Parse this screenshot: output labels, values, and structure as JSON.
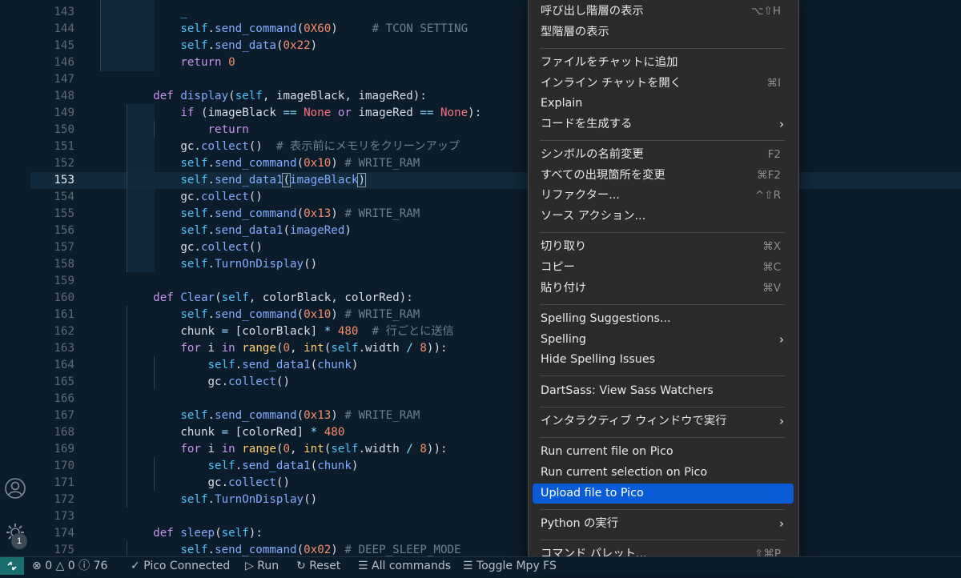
{
  "editor": {
    "current_line": 153,
    "lines": [
      {
        "n": "143",
        "html": "        <span class=\"self\">_</span>"
      },
      {
        "n": "144",
        "html": "        <span class=\"self\">self</span>.<span class=\"fn\">send_command</span>(<span class=\"num\">0X60</span>)     <span class=\"cm\"># TCON SETTING</span>"
      },
      {
        "n": "145",
        "html": "        <span class=\"self\">self</span>.<span class=\"fn\">send_data</span>(<span class=\"num\">0x22</span>)"
      },
      {
        "n": "146",
        "html": "        <span class=\"kw\">return</span> <span class=\"num\">0</span>"
      },
      {
        "n": "147",
        "html": ""
      },
      {
        "n": "148",
        "html": "    <span class=\"kw\">def</span> <span class=\"fn\">display</span>(<span class=\"self\">self</span>, imageBlack, imageRed):"
      },
      {
        "n": "149",
        "html": "        <span class=\"kw\">if</span> (imageBlack <span class=\"op\">==</span> <span class=\"none\">None</span> <span class=\"kw\">or</span> imageRed <span class=\"op\">==</span> <span class=\"none\">None</span>):"
      },
      {
        "n": "150",
        "html": "            <span class=\"kw\">return</span>"
      },
      {
        "n": "151",
        "html": "        gc.<span class=\"fn\">collect</span>()  <span class=\"cm\"># 表示前にメモリをクリーンアップ</span>"
      },
      {
        "n": "152",
        "html": "        <span class=\"self\">self</span>.<span class=\"fn\">send_command</span>(<span class=\"num\">0x10</span>) <span class=\"cm\"># WRITE_RAM</span>"
      },
      {
        "n": "153",
        "html": "        <span class=\"self\">self</span>.<span class=\"fn\">send_data1</span><span class=\"cursorbox\">(</span><span class=\"fn\">imageBlack</span><span class=\"cursorbox\">)</span>"
      },
      {
        "n": "154",
        "html": "        gc.<span class=\"fn\">collect</span>()"
      },
      {
        "n": "155",
        "html": "        <span class=\"self\">self</span>.<span class=\"fn\">send_command</span>(<span class=\"num\">0x13</span>) <span class=\"cm\"># WRITE_RAM</span>"
      },
      {
        "n": "156",
        "html": "        <span class=\"self\">self</span>.<span class=\"fn\">send_data1</span>(<span class=\"fn\">imageRed</span>)"
      },
      {
        "n": "157",
        "html": "        gc.<span class=\"fn\">collect</span>()"
      },
      {
        "n": "158",
        "html": "        <span class=\"self\">self</span>.<span class=\"fn\">TurnOnDisplay</span>()"
      },
      {
        "n": "159",
        "html": ""
      },
      {
        "n": "160",
        "html": "    <span class=\"kw\">def</span> <span class=\"fn\">Clear</span>(<span class=\"self\">self</span>, colorBlack, colorRed):"
      },
      {
        "n": "161",
        "html": "        <span class=\"self\">self</span>.<span class=\"fn\">send_command</span>(<span class=\"num\">0x10</span>) <span class=\"cm\"># WRITE_RAM</span>"
      },
      {
        "n": "162",
        "html": "        chunk <span class=\"op\">=</span> [colorBlack] <span class=\"op\">*</span> <span class=\"num\">480</span>  <span class=\"cm\"># 行ごとに送信</span>"
      },
      {
        "n": "163",
        "html": "        <span class=\"kw\">for</span> i <span class=\"kw\">in</span> <span class=\"bi\">range</span>(<span class=\"num\">0</span>, <span class=\"bi\">int</span>(<span class=\"self\">self</span>.width <span class=\"op\">/</span> <span class=\"num\">8</span>)):"
      },
      {
        "n": "164",
        "html": "            <span class=\"self\">self</span>.<span class=\"fn\">send_data1</span>(<span class=\"fn\">chunk</span>)"
      },
      {
        "n": "165",
        "html": "            gc.<span class=\"fn\">collect</span>()"
      },
      {
        "n": "166",
        "html": ""
      },
      {
        "n": "167",
        "html": "        <span class=\"self\">self</span>.<span class=\"fn\">send_command</span>(<span class=\"num\">0x13</span>) <span class=\"cm\"># WRITE_RAM</span>"
      },
      {
        "n": "168",
        "html": "        chunk <span class=\"op\">=</span> [colorRed] <span class=\"op\">*</span> <span class=\"num\">480</span>"
      },
      {
        "n": "169",
        "html": "        <span class=\"kw\">for</span> i <span class=\"kw\">in</span> <span class=\"bi\">range</span>(<span class=\"num\">0</span>, <span class=\"bi\">int</span>(<span class=\"self\">self</span>.width <span class=\"op\">/</span> <span class=\"num\">8</span>)):"
      },
      {
        "n": "170",
        "html": "            <span class=\"self\">self</span>.<span class=\"fn\">send_data1</span>(<span class=\"fn\">chunk</span>)"
      },
      {
        "n": "171",
        "html": "            gc.<span class=\"fn\">collect</span>()"
      },
      {
        "n": "172",
        "html": "        <span class=\"self\">self</span>.<span class=\"fn\">TurnOnDisplay</span>()"
      },
      {
        "n": "173",
        "html": ""
      },
      {
        "n": "174",
        "html": "    <span class=\"kw\">def</span> <span class=\"fn\">sleep</span>(<span class=\"self\">self</span>):"
      },
      {
        "n": "175",
        "html": "        <span class=\"self\">self</span>.<span class=\"fn\">send_command</span>(<span class=\"num\">0x02</span>) <span class=\"cm\"># DEEP_SLEEP_MODE</span>"
      }
    ]
  },
  "context_menu": {
    "groups": [
      [
        {
          "label": "呼び出し階層の表示",
          "shortcut": "⌥⇧H"
        },
        {
          "label": "型階層の表示",
          "shortcut": ""
        }
      ],
      [
        {
          "label": "ファイルをチャットに追加",
          "shortcut": ""
        },
        {
          "label": "インライン チャットを開く",
          "shortcut": "⌘I"
        },
        {
          "label": "Explain",
          "shortcut": ""
        },
        {
          "label": "コードを生成する",
          "shortcut": "",
          "submenu": true
        }
      ],
      [
        {
          "label": "シンボルの名前変更",
          "shortcut": "F2"
        },
        {
          "label": "すべての出現箇所を変更",
          "shortcut": "⌘F2"
        },
        {
          "label": "リファクター...",
          "shortcut": "^⇧R"
        },
        {
          "label": "ソース アクション...",
          "shortcut": ""
        }
      ],
      [
        {
          "label": "切り取り",
          "shortcut": "⌘X"
        },
        {
          "label": "コピー",
          "shortcut": "⌘C"
        },
        {
          "label": "貼り付け",
          "shortcut": "⌘V"
        }
      ],
      [
        {
          "label": "Spelling Suggestions...",
          "shortcut": ""
        },
        {
          "label": "Spelling",
          "shortcut": "",
          "submenu": true
        },
        {
          "label": "Hide Spelling Issues",
          "shortcut": ""
        }
      ],
      [
        {
          "label": "DartSass: View Sass Watchers",
          "shortcut": ""
        }
      ],
      [
        {
          "label": "インタラクティブ ウィンドウで実行",
          "shortcut": "",
          "submenu": true
        }
      ],
      [
        {
          "label": "Run current file on Pico",
          "shortcut": ""
        },
        {
          "label": "Run current selection on Pico",
          "shortcut": ""
        },
        {
          "label": "Upload file to Pico",
          "shortcut": "",
          "active": true
        }
      ],
      [
        {
          "label": "Python の実行",
          "shortcut": "",
          "submenu": true
        }
      ],
      [
        {
          "label": "コマンド パレット...",
          "shortcut": "⇧⌘P"
        }
      ]
    ]
  },
  "activity_bar": {
    "account_icon": "account-icon",
    "settings_icon": "gear-icon",
    "settings_badge": "1"
  },
  "status_bar": {
    "remote_icon": "remote-icon",
    "errors": "0",
    "warnings": "0",
    "info": "76",
    "pico_connected": "Pico Connected",
    "run": "Run",
    "reset": "Reset",
    "all_commands": "All commands",
    "toggle": "Toggle Mpy FS"
  },
  "colors": {
    "editor_bg": "#0b1d2b",
    "menu_bg": "#2b2b2d",
    "menu_active": "#0a5bd6",
    "remote_bg": "#1a6e6e"
  }
}
